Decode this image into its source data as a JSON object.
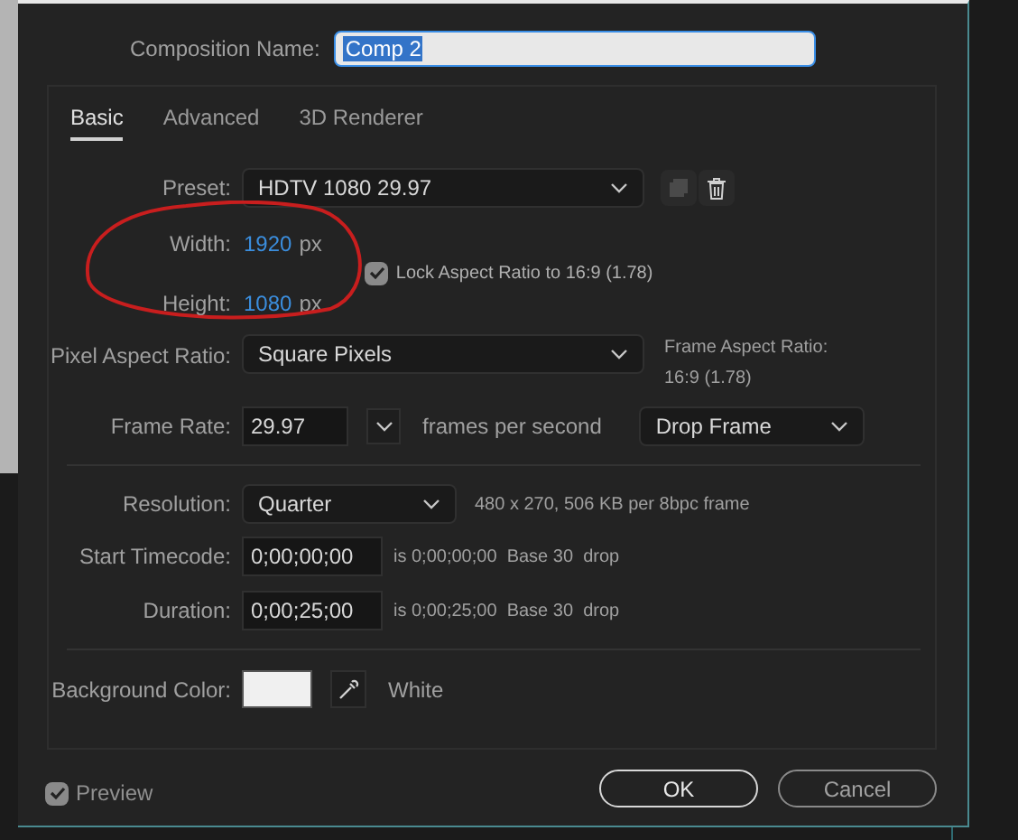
{
  "composition_name": {
    "label": "Composition Name:",
    "value": "Comp 2"
  },
  "tabs": [
    {
      "label": "Basic",
      "selected": true
    },
    {
      "label": "Advanced",
      "selected": false
    },
    {
      "label": "3D Renderer",
      "selected": false
    }
  ],
  "preset": {
    "label": "Preset:",
    "value": "HDTV 1080 29.97"
  },
  "width": {
    "label": "Width:",
    "value": "1920",
    "unit": "px"
  },
  "height": {
    "label": "Height:",
    "value": "1080",
    "unit": "px"
  },
  "lock_aspect": {
    "label": "Lock Aspect Ratio to 16:9 (1.78)",
    "checked": true
  },
  "pixel_aspect_ratio": {
    "label": "Pixel Aspect Ratio:",
    "value": "Square Pixels",
    "frame_aspect_label": "Frame Aspect Ratio:",
    "frame_aspect_value": "16:9 (1.78)"
  },
  "frame_rate": {
    "label": "Frame Rate:",
    "value": "29.97",
    "unit": "frames per second",
    "mode": "Drop Frame"
  },
  "resolution": {
    "label": "Resolution:",
    "value": "Quarter",
    "info": "480 x 270, 506 KB per 8bpc frame"
  },
  "start_timecode": {
    "label": "Start Timecode:",
    "value": "0;00;00;00",
    "info": "is 0;00;00;00  Base 30  drop"
  },
  "duration": {
    "label": "Duration:",
    "value": "0;00;25;00",
    "info": "is 0;00;25;00  Base 30  drop"
  },
  "background_color": {
    "label": "Background Color:",
    "color": "#f0f0f0",
    "name": "White"
  },
  "preview": {
    "label": "Preview",
    "checked": true
  },
  "buttons": [
    {
      "label": "OK",
      "kind": "primary"
    },
    {
      "label": "Cancel",
      "kind": "secondary"
    }
  ]
}
